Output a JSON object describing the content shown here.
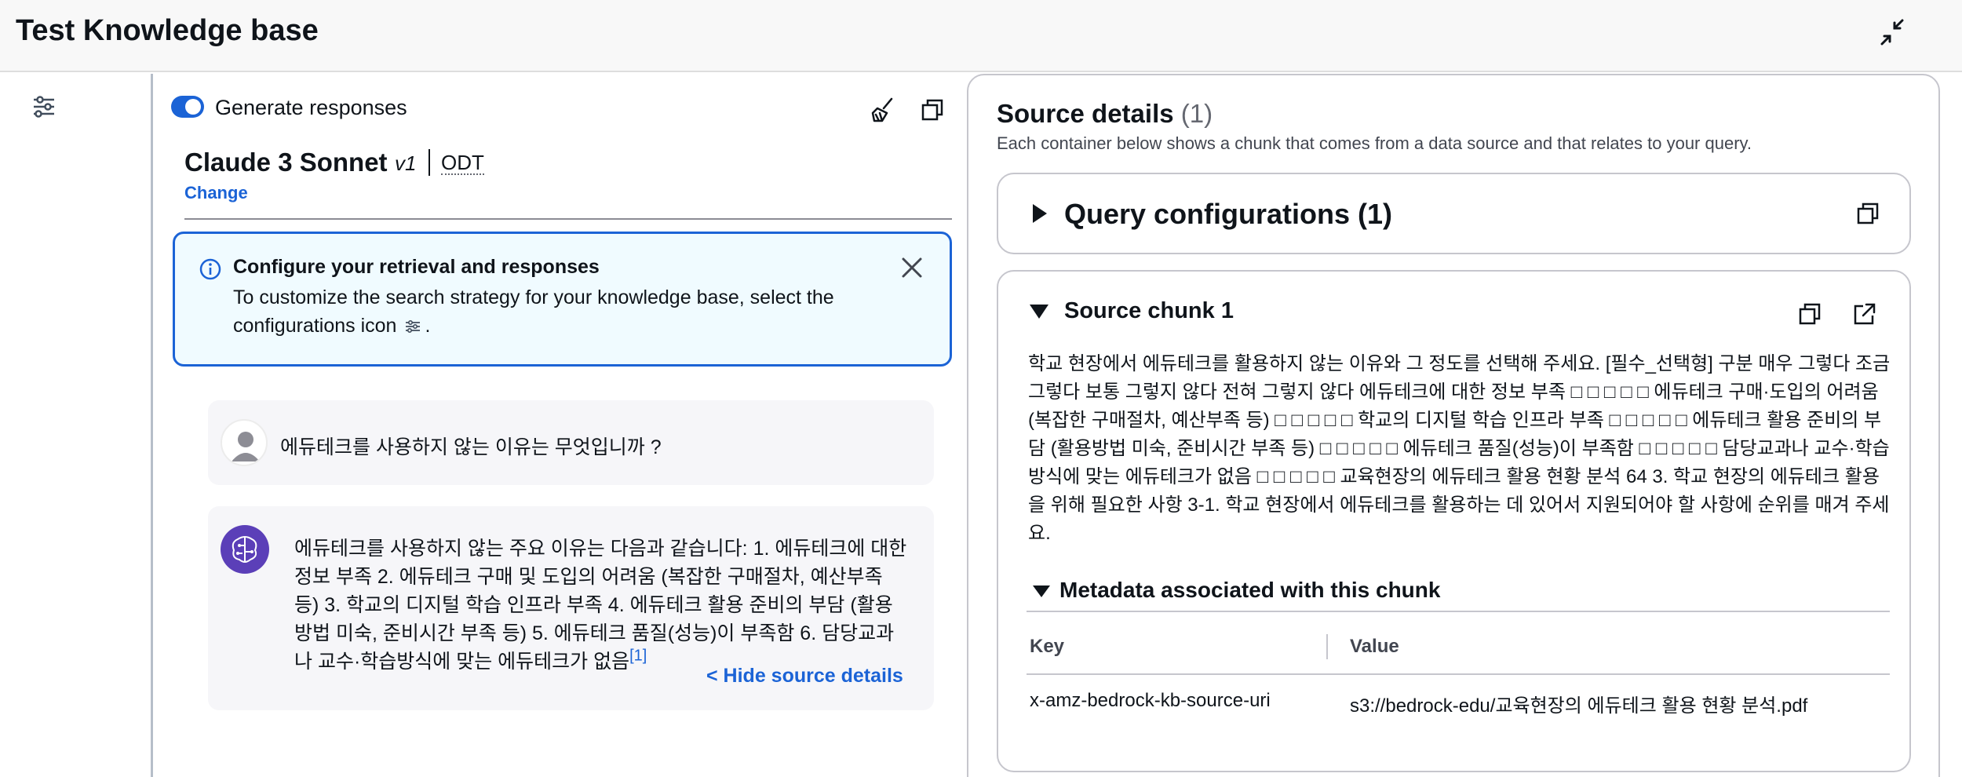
{
  "header": {
    "title": "Test Knowledge base"
  },
  "toolbar": {
    "generate_label": "Generate responses"
  },
  "model": {
    "name": "Claude 3 Sonnet",
    "version": "v1",
    "tag": "ODT",
    "change_label": "Change"
  },
  "info_alert": {
    "title": "Configure your retrieval and responses",
    "text": "To customize the search strategy for your knowledge base, select the configurations icon",
    "suffix": "."
  },
  "chat": {
    "user_message": "에듀테크를 사용하지 않는 이유는 무엇입니까 ?",
    "bot_message": "에듀테크를 사용하지 않는 주요 이유는 다음과 같습니다: 1. 에듀테크에 대한 정보 부족 2. 에듀테크 구매 및 도입의 어려움 (복잡한 구매절차, 예산부족 등) 3. 학교의 디지털 학습 인프라 부족 4. 에듀테크 활용 준비의 부담 (활용방법 미숙, 준비시간 부족 등) 5. 에듀테크 품질(성능)이 부족함 6. 담당교과나 교수·학습방식에 맞는 에듀테크가 없음",
    "citation": "[1]",
    "hide_sources_label": "< Hide source details"
  },
  "source_details": {
    "title": "Source details",
    "count": "(1)",
    "description": "Each container below shows a chunk that comes from a data source and that relates to your query.",
    "query_config_title": "Query configurations (1)",
    "chunk_title": "Source chunk 1",
    "chunk_text": "학교 현장에서 에듀테크를 활용하지 않는 이유와 그 정도를 선택해 주세요. [필수_선택형] 구분 매우 그렇다 조금 그렇다 보통 그렇지 않다 전혀 그렇지 않다 에듀테크에 대한 정보 부족 □ □ □ □ □ 에듀테크 구매·도입의 어려움 (복잡한 구매절차, 예산부족 등) □ □ □ □ □ 학교의 디지털 학습 인프라 부족 □ □ □ □ □ 에듀테크 활용 준비의 부담 (활용방법 미숙, 준비시간 부족 등) □ □ □ □ □ 에듀테크 품질(성능)이 부족함 □ □ □ □ □ 담당교과나 교수·학습방식에 맞는 에듀테크가 없음 □ □ □ □ □ 교육현장의 에듀테크 활용 현황 분석 64 3. 학교 현장의 에듀테크 활용을 위해 필요한 사항 3-1. 학교 현장에서 에듀테크를 활용하는 데 있어서 지원되어야 할 사항에 순위를 매겨 주세요.",
    "metadata_title": "Metadata associated with this chunk",
    "metadata_headers": {
      "key": "Key",
      "value": "Value"
    },
    "metadata_rows": [
      {
        "key": "x-amz-bedrock-kb-source-uri",
        "value": "s3://bedrock-edu/교육현장의 에듀테크 활용 현황 분석.pdf"
      }
    ]
  },
  "colors": {
    "accent": "#1b63d6",
    "bot_avatar": "#5b3fb8",
    "info_bg": "#f0fbff"
  },
  "icons": [
    "collapse-icon",
    "settings-sliders-icon",
    "broom-icon",
    "copy-icon",
    "info-icon",
    "close-icon",
    "user-avatar-icon",
    "ai-brain-icon",
    "external-link-icon"
  ]
}
